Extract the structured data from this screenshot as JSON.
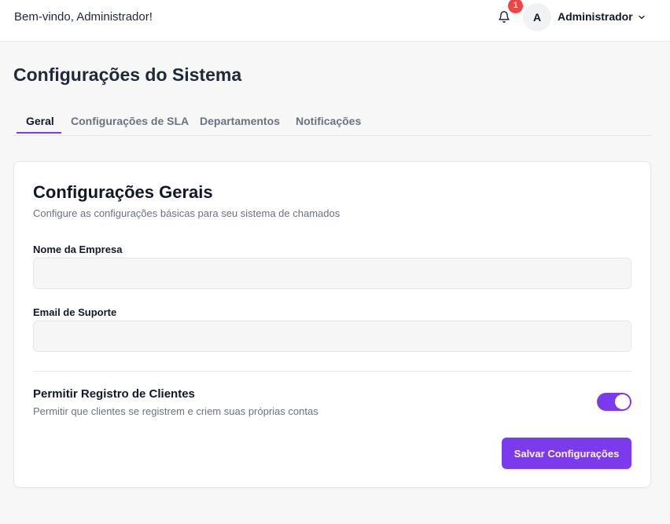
{
  "header": {
    "welcome_text": "Bem-vindo, Administrador!",
    "notification_count": "1",
    "avatar_initial": "A",
    "user_name": "Administrador",
    "icons": [
      "bell-icon",
      "chevron-down-icon"
    ]
  },
  "page": {
    "title": "Configurações do Sistema"
  },
  "tabs": [
    {
      "label": "Geral",
      "active": true
    },
    {
      "label": "Configurações de SLA",
      "active": false
    },
    {
      "label": "Departamentos",
      "active": false
    },
    {
      "label": "Notificações",
      "active": false
    }
  ],
  "card": {
    "title": "Configurações Gerais",
    "description": "Configure as configurações básicas para seu sistema de chamados",
    "fields": [
      {
        "label": "Nome da Empresa",
        "value": "",
        "placeholder": ""
      },
      {
        "label": "Email de Suporte",
        "value": "",
        "placeholder": ""
      }
    ],
    "toggle": {
      "title": "Permitir Registro de Clientes",
      "description": "Permitir que clientes se registrem e criem suas próprias contas",
      "enabled": true
    },
    "save_label": "Salvar Configurações"
  },
  "colors": {
    "accent": "#7c3aed",
    "badge": "#ef4444",
    "background": "#f7f7f8"
  }
}
